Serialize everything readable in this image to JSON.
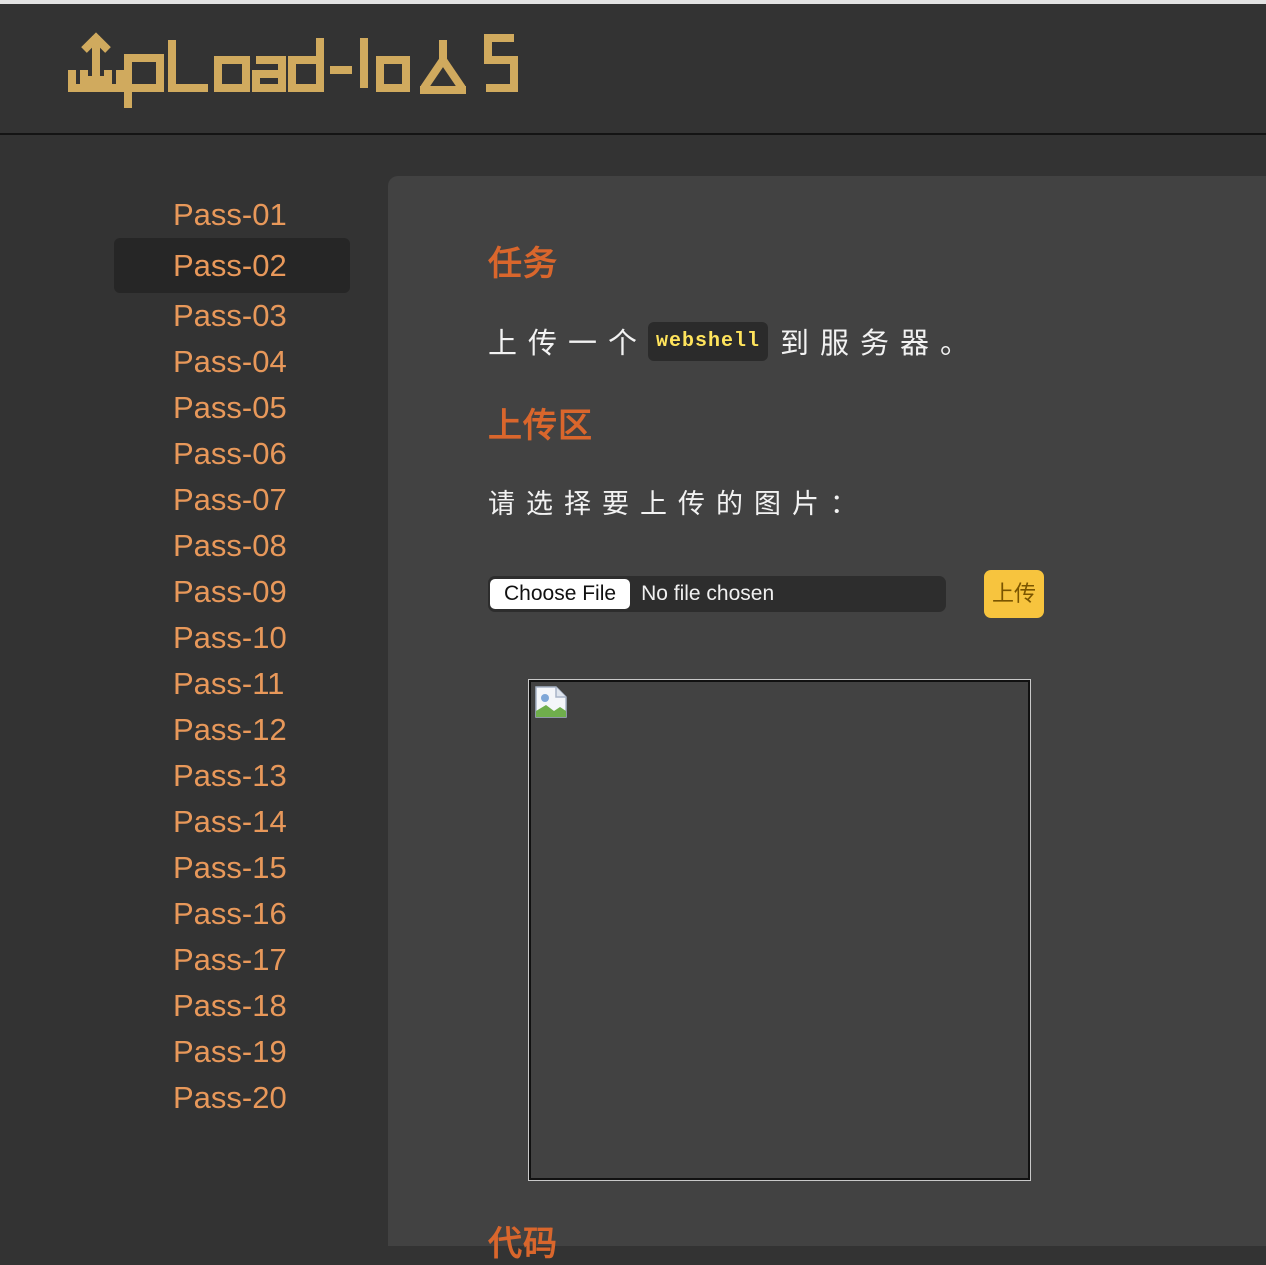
{
  "logo": {
    "text": "UpLoad-labs",
    "color": "#d0aa5e"
  },
  "sidebar": {
    "active_index": 1,
    "items": [
      {
        "label": "Pass-01"
      },
      {
        "label": "Pass-02"
      },
      {
        "label": "Pass-03"
      },
      {
        "label": "Pass-04"
      },
      {
        "label": "Pass-05"
      },
      {
        "label": "Pass-06"
      },
      {
        "label": "Pass-07"
      },
      {
        "label": "Pass-08"
      },
      {
        "label": "Pass-09"
      },
      {
        "label": "Pass-10"
      },
      {
        "label": "Pass-11"
      },
      {
        "label": "Pass-12"
      },
      {
        "label": "Pass-13"
      },
      {
        "label": "Pass-14"
      },
      {
        "label": "Pass-15"
      },
      {
        "label": "Pass-16"
      },
      {
        "label": "Pass-17"
      },
      {
        "label": "Pass-18"
      },
      {
        "label": "Pass-19"
      },
      {
        "label": "Pass-20"
      }
    ]
  },
  "main": {
    "task_heading": "任务",
    "task_prefix": "上传一个",
    "task_code": "webshell",
    "task_suffix": "到服务器。",
    "upload_heading": "上传区",
    "choose_prompt": "请选择要上传的图片：",
    "file_input": {
      "button_label": "Choose File",
      "status": "No file chosen"
    },
    "upload_button": "上传",
    "preview_icon": "broken-image-icon",
    "code_heading": "代码"
  },
  "colors": {
    "accent": "#d9662c",
    "link": "#e8985a",
    "code": "#ffe45c",
    "button": "#f7c43e"
  }
}
